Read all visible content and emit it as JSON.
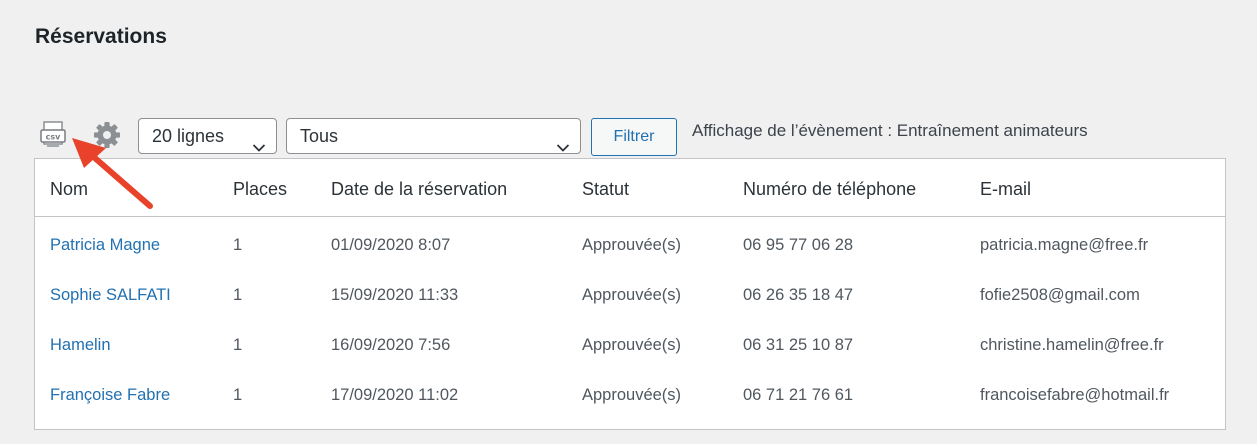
{
  "page": {
    "title": "Réservations"
  },
  "toolbar": {
    "export_icon": "csv-export-icon",
    "settings_icon": "gear-icon",
    "rows_select": {
      "selected": "20 lignes"
    },
    "status_select": {
      "selected": "Tous"
    },
    "filter_button": "Filtrer",
    "event_info": "Affichage de l’évènement : Entraînement animateurs"
  },
  "annotation": {
    "color": "#e8432a"
  },
  "table": {
    "headers": [
      "Nom",
      "Places",
      "Date de la réservation",
      "Statut",
      "Numéro de téléphone",
      "E-mail"
    ],
    "rows": [
      [
        "Patricia Magne",
        "1",
        "01/09/2020 8:07",
        "Approuvée(s)",
        "06 95 77 06 28",
        "patricia.magne@free.fr"
      ],
      [
        "Sophie SALFATI",
        "1",
        "15/09/2020 11:33",
        "Approuvée(s)",
        "06 26 35 18 47",
        "fofie2508@gmail.com"
      ],
      [
        "Hamelin",
        "1",
        "16/09/2020 7:56",
        "Approuvée(s)",
        "06 31 25 10 87",
        "christine.hamelin@free.fr"
      ],
      [
        "Françoise Fabre",
        "1",
        "17/09/2020 11:02",
        "Approuvée(s)",
        "06 71 21 76 61",
        "francoisefabre@hotmail.fr"
      ]
    ]
  },
  "colors": {
    "link": "#2271b1",
    "background": "#f0f0f1",
    "border": "#c3c4c7"
  }
}
